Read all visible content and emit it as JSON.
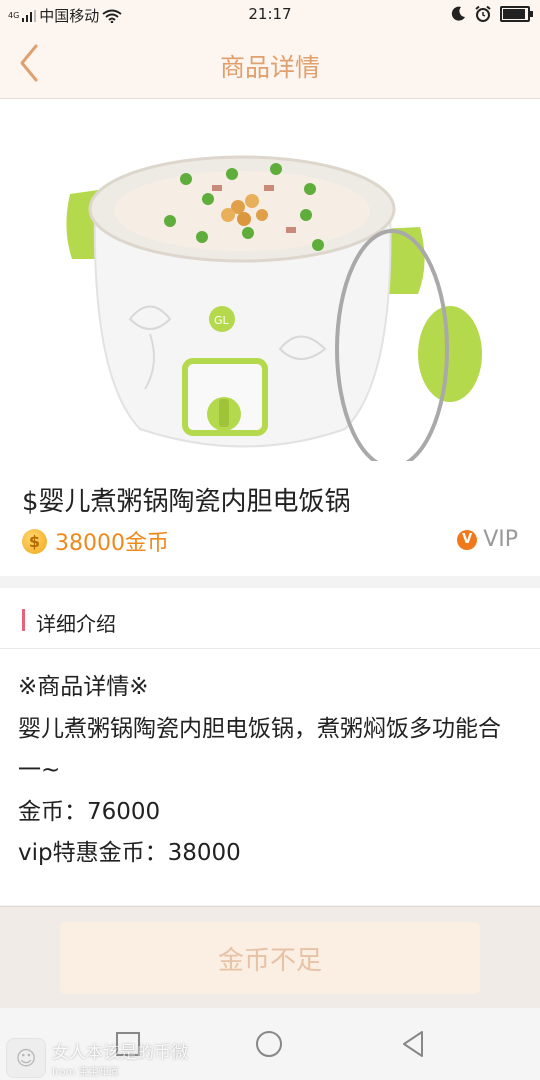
{
  "status_bar": {
    "signal_sup": "4G",
    "carrier": "中国移动",
    "time": "21:17"
  },
  "nav": {
    "title": "商品详情",
    "back_icon": "chevron-left-icon"
  },
  "product": {
    "title": "$婴儿煮粥锅陶瓷内胆电饭锅",
    "coin_symbol": "$",
    "price": "38000金币",
    "vip_badge": "V",
    "vip_label": "VIP"
  },
  "section": {
    "title": "详细介绍"
  },
  "detail": {
    "lines": [
      "※商品详情※",
      "婴儿煮粥锅陶瓷内胆电饭锅，煮粥焖饭多功能合一~",
      "金币：76000",
      "vip特惠金币：38000"
    ]
  },
  "footer": {
    "button_label": "金币不足"
  },
  "watermark": {
    "text": "女人本该是的币微",
    "sub": "from 宝宝知道"
  },
  "colors": {
    "accent": "#e0a06e",
    "price": "#ee8a1c",
    "section_bar": "#e4647b",
    "button_bg": "#fbeee3",
    "button_text": "#e8c2a5"
  }
}
